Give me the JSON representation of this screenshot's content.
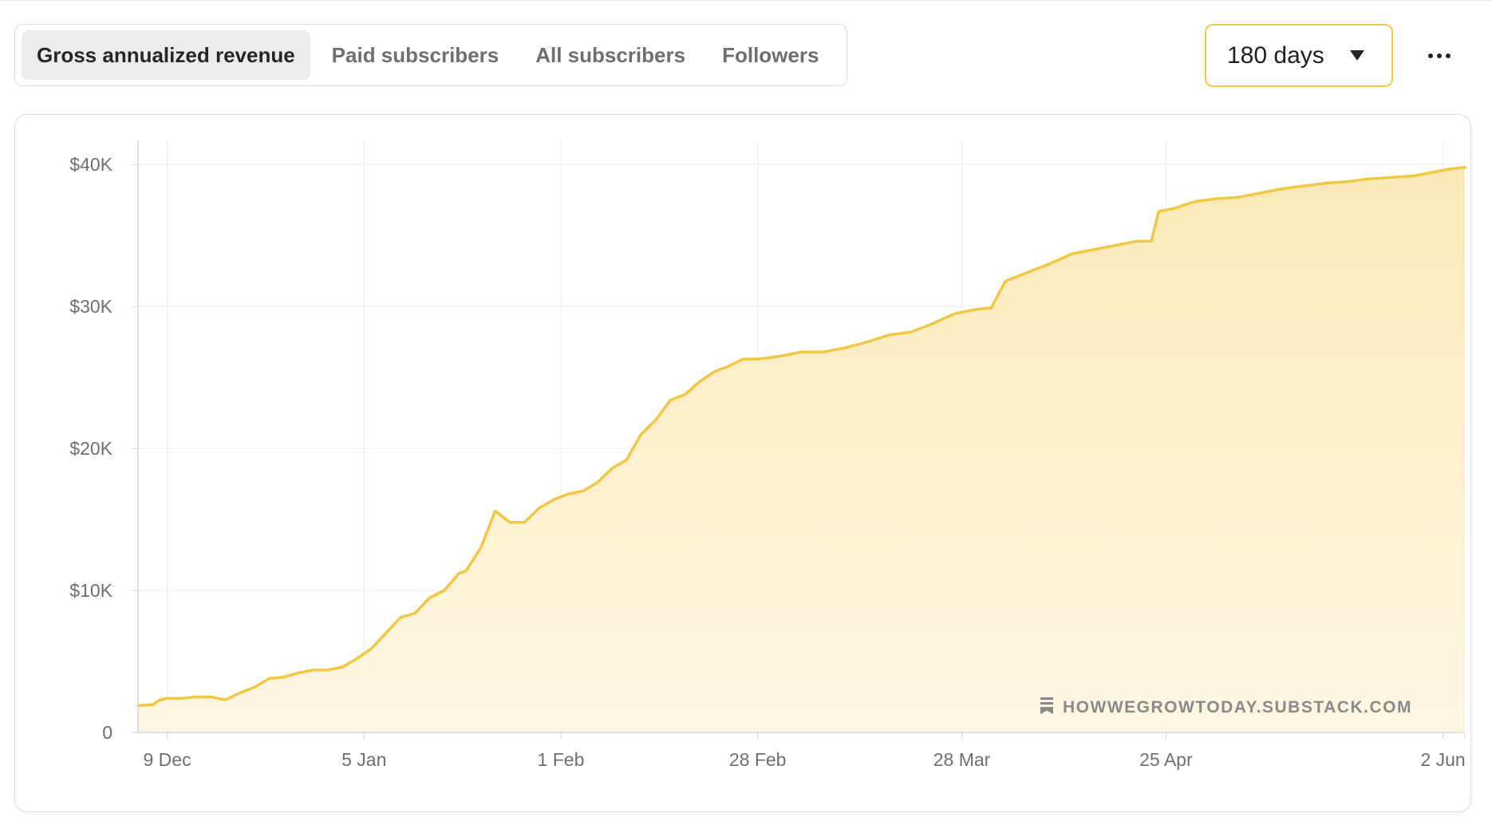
{
  "tabs": [
    {
      "label": "Gross annualized revenue",
      "active": true
    },
    {
      "label": "Paid subscribers",
      "active": false
    },
    {
      "label": "All subscribers",
      "active": false
    },
    {
      "label": "Followers",
      "active": false
    }
  ],
  "range_select": {
    "value": "180 days",
    "icon": "chevron-down-icon"
  },
  "more_menu": {
    "icon": "more-horizontal-icon"
  },
  "watermark": {
    "text": "HOWWEGROWTODAY.SUBSTACK.COM",
    "icon": "substack-icon"
  },
  "colors": {
    "line": "#f2c744",
    "fill_top": "#fbe9b7",
    "fill_bottom": "#fdf6e3",
    "accent_border": "#f5c842"
  },
  "chart_data": {
    "type": "area",
    "title": "",
    "xlabel": "",
    "ylabel": "",
    "ylim": [
      0,
      41700
    ],
    "y_ticks": [
      0,
      10000,
      20000,
      30000,
      40000
    ],
    "y_tick_labels": [
      "0",
      "$10K",
      "$20K",
      "$30K",
      "$40K"
    ],
    "x_ticks": [
      "2024-12-09",
      "2025-01-05",
      "2025-02-01",
      "2025-02-28",
      "2025-03-28",
      "2025-04-25",
      "2025-06-02"
    ],
    "x_tick_labels": [
      "9 Dec",
      "5 Jan",
      "1 Feb",
      "28 Feb",
      "28 Mar",
      "25 Apr",
      "2 Jun"
    ],
    "xlim": [
      "2024-12-05",
      "2025-06-05"
    ],
    "grid": true,
    "series": [
      {
        "x": [
          "2024-12-05",
          "2024-12-07",
          "2024-12-08",
          "2024-12-09",
          "2024-12-11",
          "2024-12-13",
          "2024-12-15",
          "2024-12-17",
          "2024-12-19",
          "2024-12-21",
          "2024-12-23",
          "2024-12-25",
          "2024-12-27",
          "2024-12-29",
          "2024-12-31",
          "2025-01-02",
          "2025-01-04",
          "2025-01-06",
          "2025-01-08",
          "2025-01-10",
          "2025-01-12",
          "2025-01-14",
          "2025-01-16",
          "2025-01-17",
          "2025-01-18",
          "2025-01-19",
          "2025-01-21",
          "2025-01-23",
          "2025-01-25",
          "2025-01-27",
          "2025-01-29",
          "2025-01-31",
          "2025-02-02",
          "2025-02-04",
          "2025-02-06",
          "2025-02-07",
          "2025-02-08",
          "2025-02-10",
          "2025-02-12",
          "2025-02-14",
          "2025-02-16",
          "2025-02-18",
          "2025-02-20",
          "2025-02-22",
          "2025-02-24",
          "2025-02-26",
          "2025-02-28",
          "2025-03-03",
          "2025-03-06",
          "2025-03-09",
          "2025-03-12",
          "2025-03-15",
          "2025-03-18",
          "2025-03-21",
          "2025-03-24",
          "2025-03-27",
          "2025-03-30",
          "2025-04-01",
          "2025-04-03",
          "2025-04-06",
          "2025-04-09",
          "2025-04-12",
          "2025-04-15",
          "2025-04-18",
          "2025-04-21",
          "2025-04-23",
          "2025-04-24",
          "2025-04-26",
          "2025-04-29",
          "2025-05-02",
          "2025-05-05",
          "2025-05-08",
          "2025-05-11",
          "2025-05-14",
          "2025-05-17",
          "2025-05-20",
          "2025-05-23",
          "2025-05-26",
          "2025-05-29",
          "2025-06-01",
          "2025-06-03",
          "2025-06-05"
        ],
        "y": [
          1900,
          1950,
          2300,
          2400,
          2400,
          2500,
          2500,
          2300,
          2800,
          3200,
          3800,
          3900,
          4200,
          4400,
          4400,
          4600,
          5200,
          5900,
          7000,
          8100,
          8400,
          9500,
          10000,
          10600,
          11200,
          11400,
          13000,
          15600,
          14800,
          14800,
          15800,
          16400,
          16800,
          17000,
          17600,
          18100,
          18600,
          19200,
          21000,
          22000,
          23400,
          23800,
          24700,
          25400,
          25800,
          26300,
          26300,
          26500,
          26800,
          26800,
          27100,
          27500,
          28000,
          28200,
          28800,
          29500,
          29800,
          29900,
          31800,
          32400,
          33000,
          33700,
          34000,
          34300,
          34600,
          34600,
          36700,
          36900,
          37400,
          37600,
          37700,
          38000,
          38300,
          38500,
          38700,
          38800,
          39000,
          39100,
          39200,
          39500,
          39700,
          39800
        ]
      }
    ]
  }
}
